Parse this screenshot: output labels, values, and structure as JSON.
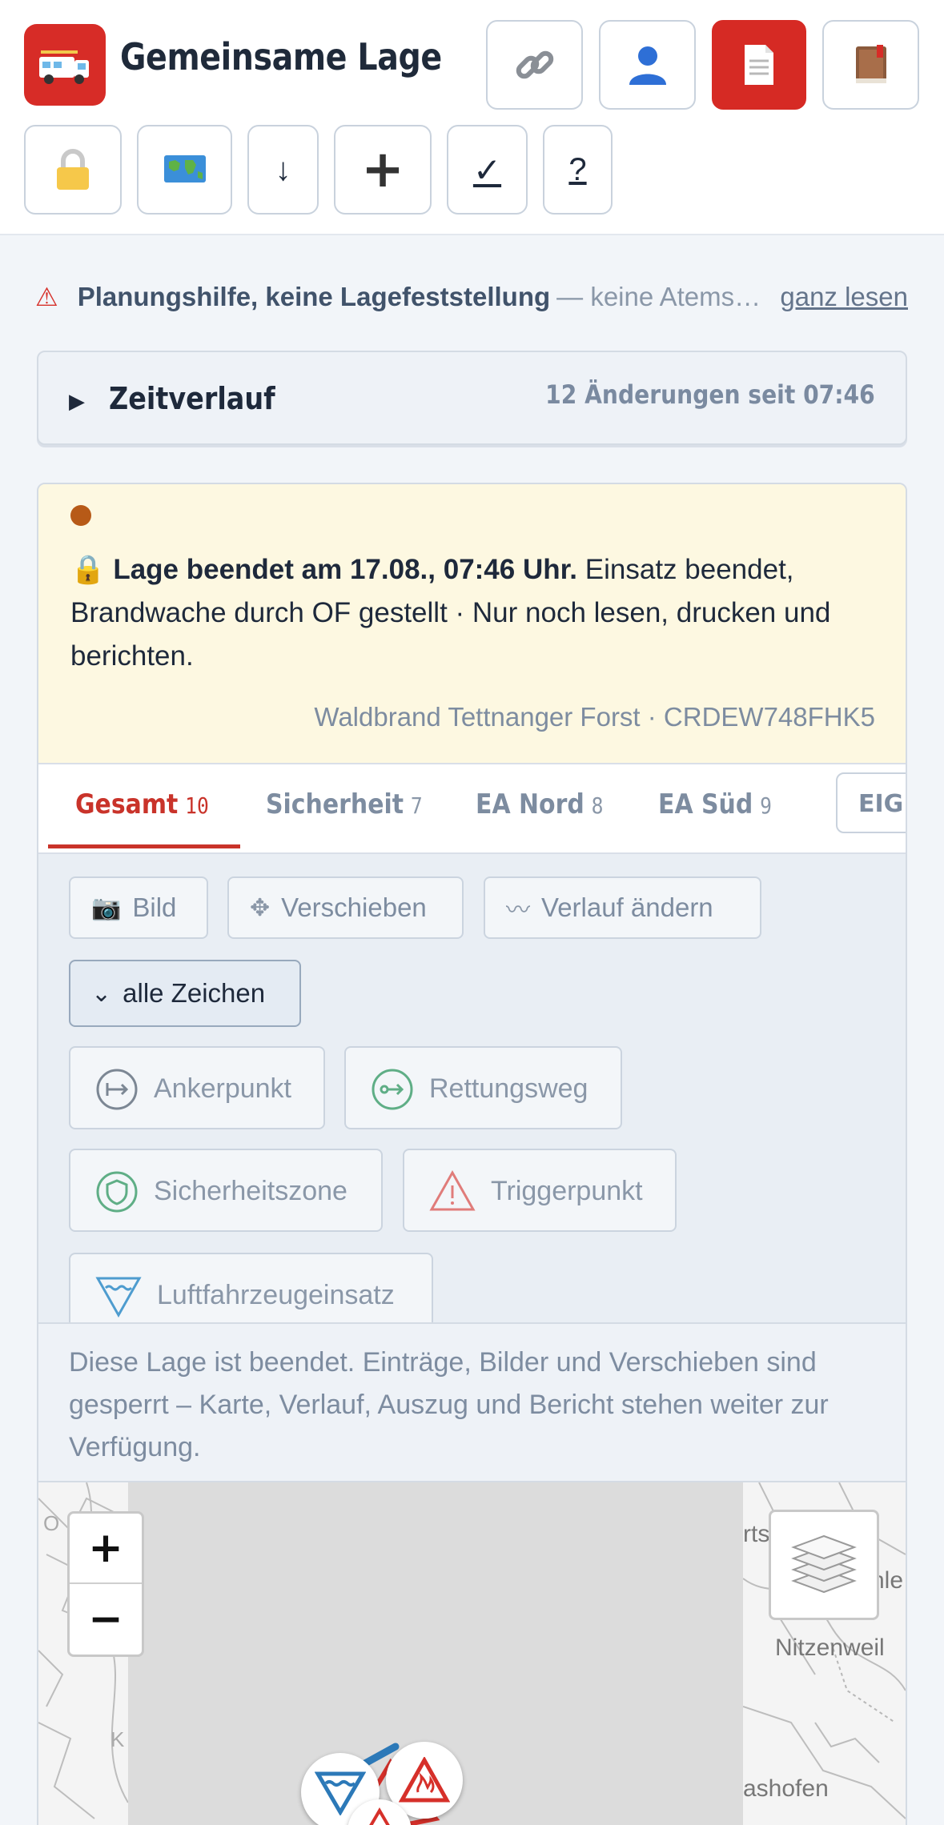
{
  "header": {
    "title": "Gemeinsame Lage",
    "logo_icon": "fire-truck-icon",
    "buttons": [
      {
        "name": "link-icon"
      },
      {
        "name": "user-icon"
      },
      {
        "name": "document-icon"
      },
      {
        "name": "book-icon"
      },
      {
        "name": "lock-icon"
      },
      {
        "name": "map-icon"
      },
      {
        "name": "download-icon",
        "glyph": "↓"
      },
      {
        "name": "plus-icon",
        "glyph": "+"
      },
      {
        "name": "checkmark-icon",
        "glyph": "✓"
      },
      {
        "name": "help-icon",
        "glyph": "?"
      }
    ]
  },
  "warning": {
    "icon": "⚠",
    "strong": "Planungshilfe, keine Lagefeststellung",
    "rest": "— keine Atems…",
    "link": "ganz lesen"
  },
  "timeline": {
    "arrow": "▶",
    "title": "Zeitverlauf",
    "meta": "12 Änderungen seit 07:46"
  },
  "notice": {
    "lock": "🔒",
    "bold": "Lage beendet am 17.08., 07:46 Uhr.",
    "text": " Einsatz beendet, Brandwache durch OF gestellt · Nur noch lesen, drucken und berichten.",
    "signature": "Waldbrand Tettnanger Forst · CRDEW748FHK5"
  },
  "tabs": [
    {
      "label": "Gesamt",
      "count": "10"
    },
    {
      "label": "Sicherheit",
      "count": "7"
    },
    {
      "label": "EA Nord",
      "count": "8"
    },
    {
      "label": "EA Süd",
      "count": "9"
    },
    {
      "label": "EIGENE"
    }
  ],
  "tools": {
    "image": "Bild",
    "move": "Verschieben",
    "route": "Verlauf ändern",
    "all_symbols": "alle Zeichen",
    "select_arrow": "⌄"
  },
  "symbols": [
    "Ankerpunkt",
    "Rettungsweg",
    "Sicherheitszone",
    "Triggerpunkt",
    "Luftfahrzeugeinsatz"
  ],
  "locked_text": "Diese Lage ist beendet. Einträge, Bilder und Verschieben sind gesperrt – Karte, Verlauf, Auszug und Bericht stehen weiter zur Verfügung.",
  "map": {
    "zoom_in": "+",
    "zoom_out": "−",
    "towns": [
      "Nitzenweil",
      "ashofen",
      "rts",
      "hle"
    ]
  },
  "colors": {
    "brand_red": "#d62a24",
    "active_tab": "#c9332a",
    "notice_bg": "#fdf8e1"
  }
}
